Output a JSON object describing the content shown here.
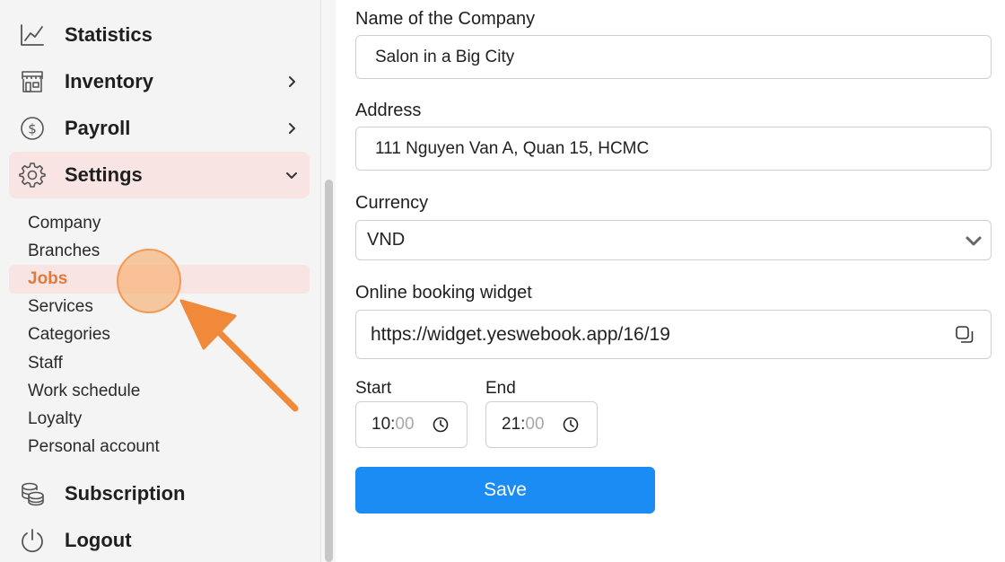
{
  "sidebar": {
    "items": [
      {
        "label": "Statistics",
        "icon": "chart-line-icon"
      },
      {
        "label": "Inventory",
        "icon": "store-icon"
      },
      {
        "label": "Payroll",
        "icon": "dollar-circle-icon"
      },
      {
        "label": "Settings",
        "icon": "gear-icon"
      },
      {
        "label": "Subscription",
        "icon": "coins-icon"
      },
      {
        "label": "Logout",
        "icon": "power-icon"
      }
    ],
    "settings_sub": [
      "Company",
      "Branches",
      "Jobs",
      "Services",
      "Categories",
      "Staff",
      "Work schedule",
      "Loyalty",
      "Personal account"
    ],
    "current_sub": "Jobs"
  },
  "form": {
    "company_label": "Name of the Company",
    "company_value": "Salon in a Big City",
    "address_label": "Address",
    "address_value": "111 Nguyen Van A, Quan 15, HCMC",
    "currency_label": "Currency",
    "currency_value": "VND",
    "widget_label": "Online booking widget",
    "widget_value": "https://widget.yeswebook.app/16/19",
    "start_label": "Start",
    "start_hh": "10",
    "start_mm": "00",
    "end_label": "End",
    "end_hh": "21",
    "end_mm": "00",
    "save_label": "Save"
  },
  "colors": {
    "accent_orange": "#e07a3c",
    "active_bg": "#f8e5e3",
    "save_blue": "#1a8cf3",
    "annotation": "#f08a3a"
  }
}
